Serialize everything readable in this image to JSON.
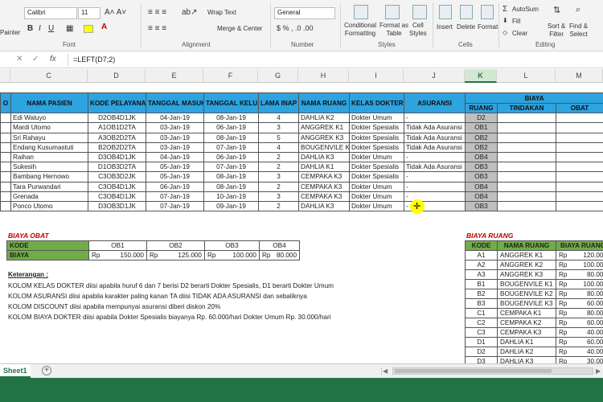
{
  "ribbon": {
    "painter": "Painter",
    "font_name": "Calibri",
    "font_size": "11",
    "wrap_text": "Wrap Text",
    "merge_center": "Merge & Center",
    "number_format": "General",
    "conditional_formatting": "Conditional\nFormatting",
    "format_as_table": "Format as\nTable",
    "cell_styles": "Cell\nStyles",
    "insert": "Insert",
    "delete": "Delete",
    "format": "Format",
    "autosum": "AutoSum",
    "fill": "Fill",
    "clear": "Clear",
    "sort_filter": "Sort &\nFilter",
    "find_select": "Find &\nSelect",
    "groups": {
      "font": "Font",
      "alignment": "Alignment",
      "number": "Number",
      "styles": "Styles",
      "cells": "Cells",
      "editing": "Editing"
    }
  },
  "formula_bar": {
    "fx": "fx",
    "formula": "=LEFT(D7;2)"
  },
  "columns": [
    {
      "label": "C",
      "selected": false
    },
    {
      "label": "D",
      "selected": false
    },
    {
      "label": "E",
      "selected": false
    },
    {
      "label": "F",
      "selected": false
    },
    {
      "label": "G",
      "selected": false
    },
    {
      "label": "H",
      "selected": false
    },
    {
      "label": "I",
      "selected": false
    },
    {
      "label": "J",
      "selected": false
    },
    {
      "label": "K",
      "selected": true
    },
    {
      "label": "L",
      "selected": false
    },
    {
      "label": "M",
      "selected": false
    }
  ],
  "main_table": {
    "headers": [
      "NAMA PASIEN",
      "KODE PELAYANAN",
      "TANGGAL MASUK",
      "TANGGAL KELUAR",
      "LAMA INAP",
      "NAMA RUANG",
      "KELAS DOKTER",
      "ASURANSI"
    ],
    "biaya_header": "BIAYA",
    "sub_headers": [
      "RUANG",
      "TINDAKAN",
      "OBAT"
    ],
    "rows": [
      [
        "Edi Waluyo",
        "D2OB4D1JK",
        "04-Jan-19",
        "08-Jan-19",
        "4",
        "DAHLIA K2",
        "Dokter Umum",
        "-",
        "D2"
      ],
      [
        "Mardi Utomo",
        "A1OB1D2TA",
        "03-Jan-19",
        "06-Jan-19",
        "3",
        "ANGGREK K1",
        "Dokter Spesialis",
        "Tidak Ada Asuransi",
        "OB1"
      ],
      [
        "Sri Rahayu",
        "A3OB2D2TA",
        "03-Jan-19",
        "08-Jan-19",
        "5",
        "ANGGREK K3",
        "Dokter Spesialis",
        "Tidak Ada Asuransi",
        "OB2"
      ],
      [
        "Endang Kusumastuti",
        "B2OB2D2TA",
        "03-Jan-19",
        "07-Jan-19",
        "4",
        "BOUGENVILE K2",
        "Dokter Spesialis",
        "Tidak Ada Asuransi",
        "OB2"
      ],
      [
        "Raihan",
        "D3OB4D1JK",
        "04-Jan-19",
        "06-Jan-19",
        "2",
        "DAHLIA K3",
        "Dokter Umum",
        "-",
        "OB4"
      ],
      [
        "Sukesih",
        "D1OB3D2TA",
        "05-Jan-19",
        "07-Jan-19",
        "2",
        "DAHLIA K1",
        "Dokter Spesialis",
        "Tidak Ada Asuransi",
        "OB3"
      ],
      [
        "Bambang Hernowo",
        "C3OB3D2JK",
        "05-Jan-19",
        "08-Jan-19",
        "3",
        "CEMPAKA K3",
        "Dokter Spesialis",
        "-",
        "OB3"
      ],
      [
        "Tara Purwandari",
        "C3OB4D1JK",
        "06-Jan-19",
        "08-Jan-19",
        "2",
        "CEMPAKA K3",
        "Dokter Umum",
        "-",
        "OB4"
      ],
      [
        "Grenada",
        "C3OB4D1JK",
        "07-Jan-19",
        "10-Jan-19",
        "3",
        "CEMPAKA K3",
        "Dokter Umum",
        "-",
        "OB4"
      ],
      [
        "Ponco Utomo",
        "D3OB3D1JK",
        "07-Jan-19",
        "09-Jan-19",
        "2",
        "DAHLIA K3",
        "Dokter Umum",
        "-",
        "OB3"
      ]
    ]
  },
  "biaya_obat": {
    "title": "BIAYA OBAT",
    "kode_label": "KODE",
    "biaya_label": "BIAYA",
    "items": [
      {
        "kode": "OB1",
        "rp": "Rp",
        "value": "150.000"
      },
      {
        "kode": "OB2",
        "rp": "Rp",
        "value": "125.000"
      },
      {
        "kode": "OB3",
        "rp": "Rp",
        "value": "100.000"
      },
      {
        "kode": "OB4",
        "rp": "Rp",
        "value": "80.000"
      }
    ]
  },
  "keterangan": {
    "title": "Keterangan :",
    "lines": [
      "KOLOM KELAS DOKTER diisi apabila huruf 6 dan 7 berisi D2 berarti Dokter Spesialis, D1 berarti Dokter Umum",
      "KOLOM ASURANSI diisi apabila karakter paling kanan TA diisi TIDAK ADA ASURANSI dan sebaliknya",
      "KOLOM DISCOUNT diisi apabila mempunyai asuransi diberi diskon 20%",
      "KOLOM BIAYA DOKTER diisi apabila Dokter Spesialis biayanya Rp. 60.000/hari Dokter Umum Rp. 30.000/hari"
    ]
  },
  "biaya_ruang": {
    "title": "BIAYA RUANG",
    "headers": [
      "KODE",
      "NAMA RUANG",
      "BIAYA RUANG"
    ],
    "rows": [
      [
        "A1",
        "ANGGREK K1",
        "Rp",
        "120.000"
      ],
      [
        "A2",
        "ANGGREK K2",
        "Rp",
        "100.000"
      ],
      [
        "A3",
        "ANGGREK K3",
        "Rp",
        "80.000"
      ],
      [
        "B1",
        "BOUGENVILE K1",
        "Rp",
        "100.000"
      ],
      [
        "B2",
        "BOUGENVILE K2",
        "Rp",
        "80.000"
      ],
      [
        "B3",
        "BOUGENVILE K3",
        "Rp",
        "60.000"
      ],
      [
        "C1",
        "CEMPAKA K1",
        "Rp",
        "80.000"
      ],
      [
        "C2",
        "CEMPAKA K2",
        "Rp",
        "60.000"
      ],
      [
        "C3",
        "CEMPAKA K3",
        "Rp",
        "40.000"
      ],
      [
        "D1",
        "DAHLIA K1",
        "Rp",
        "60.000"
      ],
      [
        "D2",
        "DAHLIA K2",
        "Rp",
        "40.000"
      ],
      [
        "D3",
        "DAHLIA K3",
        "Rp",
        "30.000"
      ]
    ]
  },
  "sheet_tab": "Sheet1",
  "colors": {
    "header_blue": "#2da3e0",
    "green": "#70ad47",
    "excel_green": "#217346",
    "red": "#c00000",
    "gray": "#bfbfbf"
  }
}
